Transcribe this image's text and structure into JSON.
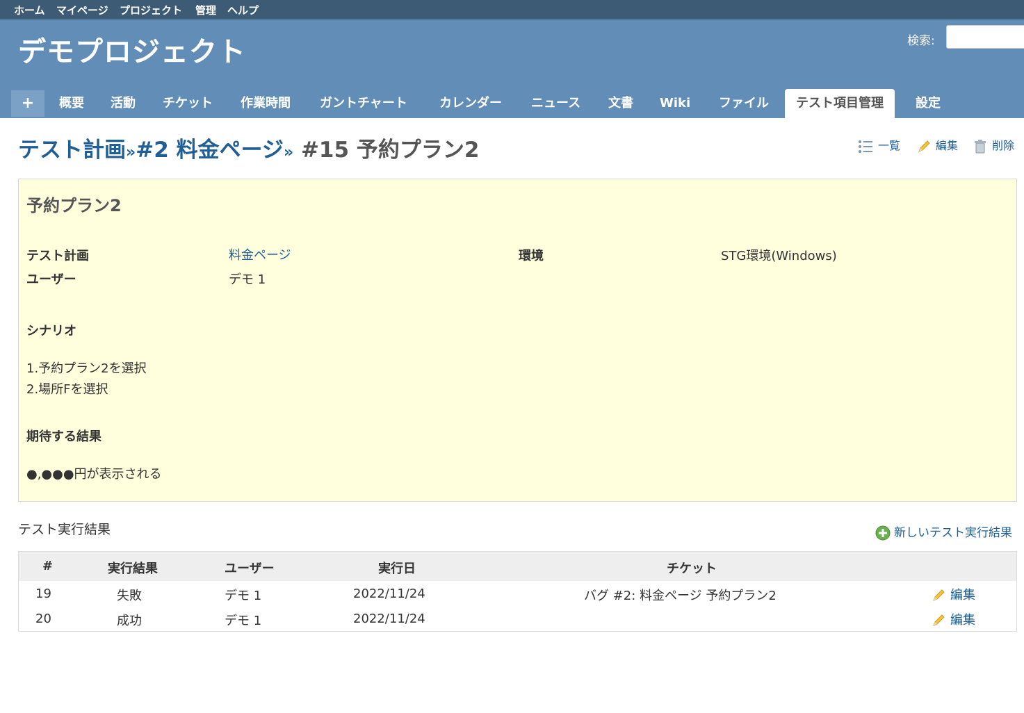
{
  "top_menu": [
    "ホーム",
    "マイページ",
    "プロジェクト",
    "管理",
    "ヘルプ"
  ],
  "header": {
    "project_title": "デモプロジェクト",
    "search_label": "検索:"
  },
  "tabs": {
    "new": "+",
    "items": [
      "概要",
      "活動",
      "チケット",
      "作業時間",
      "ガントチャート",
      "カレンダー",
      "ニュース",
      "文書",
      "Wiki",
      "ファイル",
      "テスト項目管理",
      "設定"
    ],
    "selected": "テスト項目管理"
  },
  "page": {
    "crumb_plan": "テスト計画",
    "sep": "»",
    "crumb_page": "#2 料金ページ",
    "title": "#15 予約プラン2"
  },
  "contextual": {
    "list": "一覧",
    "edit": "編集",
    "delete": "削除"
  },
  "issue": {
    "subject": "予約プラン2",
    "plan_label": "テスト計画",
    "plan_value": "料金ページ",
    "env_label": "環境",
    "env_value": "STG環境(Windows)",
    "user_label": "ユーザー",
    "user_value": "デモ 1",
    "scenario_label": "シナリオ",
    "scenario_lines": [
      "1.予約プラン2を選択",
      "2.場所Fを選択"
    ],
    "expected_label": "期待する結果",
    "expected_value": "●,●●●円が表示される"
  },
  "results": {
    "title": "テスト実行結果",
    "new_link": "新しいテスト実行結果",
    "columns": [
      "#",
      "実行結果",
      "ユーザー",
      "実行日",
      "チケット"
    ],
    "rows": [
      {
        "id": "19",
        "result": "失敗",
        "user": "デモ 1",
        "date": "2022/11/24",
        "ticket": "バグ #2: 料金ページ 予約プラン2",
        "edit": "編集"
      },
      {
        "id": "20",
        "result": "成功",
        "user": "デモ 1",
        "date": "2022/11/24",
        "ticket": "",
        "edit": "編集"
      }
    ]
  },
  "colors": {
    "header_bg": "#628db6",
    "top_menu_bg": "#3e5b76",
    "link": "#1f5f96",
    "issue_bg": "#ffffdd"
  }
}
